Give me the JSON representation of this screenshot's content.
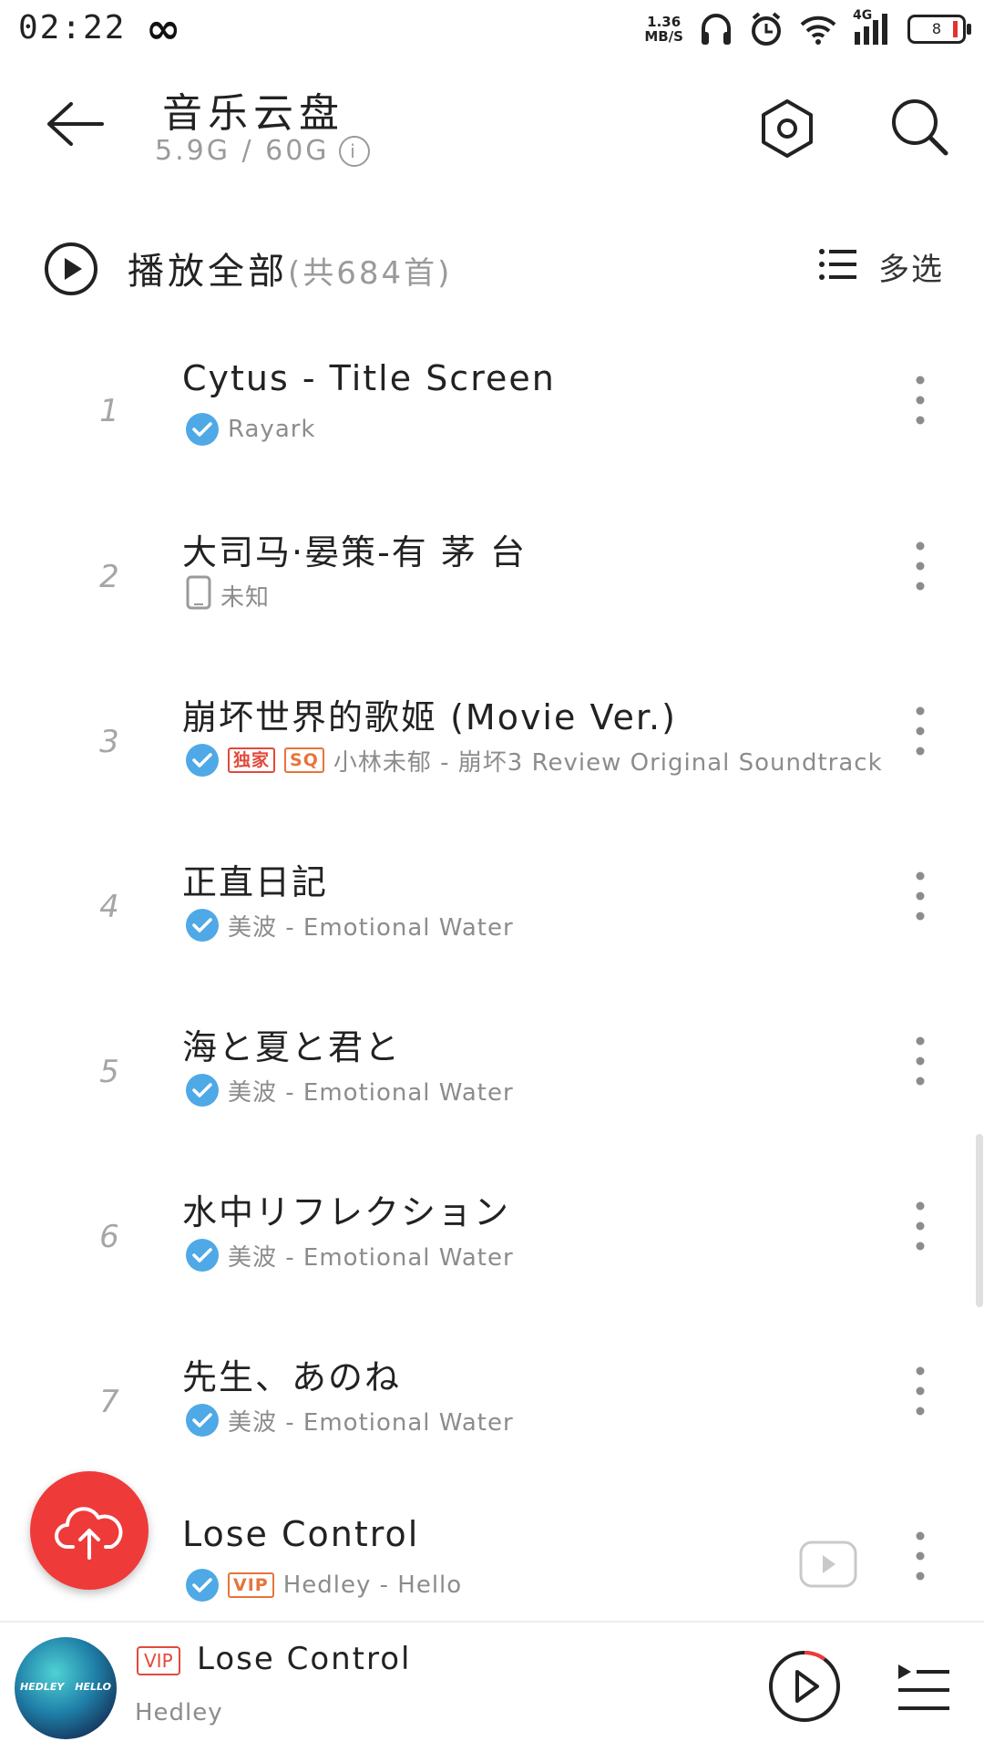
{
  "status_bar": {
    "time": "02:22",
    "infinity": "∞",
    "net_speed_value": "1.36",
    "net_speed_unit": "MB/S",
    "network_label": "4G",
    "battery": "8"
  },
  "header": {
    "title": "音乐云盘",
    "storage": "5.9G / 60G",
    "info_icon": "i"
  },
  "play_all": {
    "label": "播放全部",
    "count": "(共684首)",
    "multi_select": "多选"
  },
  "songs": [
    {
      "index": "1",
      "title": "Cytus - Title Screen",
      "source": "cloud-check",
      "subtitle": "Rayark"
    },
    {
      "index": "2",
      "title": "大司马·晏策-有 茅 台",
      "source": "phone",
      "subtitle": "未知"
    },
    {
      "index": "3",
      "title": "崩坏世界的歌姬 (Movie Ver.)",
      "source": "cloud-check",
      "badges": [
        "独家",
        "SQ"
      ],
      "subtitle": "小林未郁 - 崩坏3 Review Original Soundtrack"
    },
    {
      "index": "4",
      "title": "正直日記",
      "source": "cloud-check",
      "subtitle": "美波 - Emotional Water"
    },
    {
      "index": "5",
      "title": "海と夏と君と",
      "source": "cloud-check",
      "subtitle": "美波 - Emotional Water"
    },
    {
      "index": "6",
      "title": "水中リフレクション",
      "source": "cloud-check",
      "subtitle": "美波 - Emotional Water"
    },
    {
      "index": "7",
      "title": "先生、あのね",
      "source": "cloud-check",
      "subtitle": "美波 - Emotional Water"
    },
    {
      "index": "",
      "title": "Lose Control",
      "source": "cloud-check",
      "badges": [
        "VIP"
      ],
      "subtitle": "Hedley - Hello"
    }
  ],
  "player": {
    "vip": "VIP",
    "title": "Lose Control",
    "artist": "Hedley",
    "album_text_left": "HEDLEY",
    "album_text_right": "HELLO"
  },
  "colors": {
    "accent_red": "#ef3a3a",
    "check_blue": "#4fa9e6",
    "badge_red": "#e14a3b",
    "badge_orange": "#e8743a"
  }
}
